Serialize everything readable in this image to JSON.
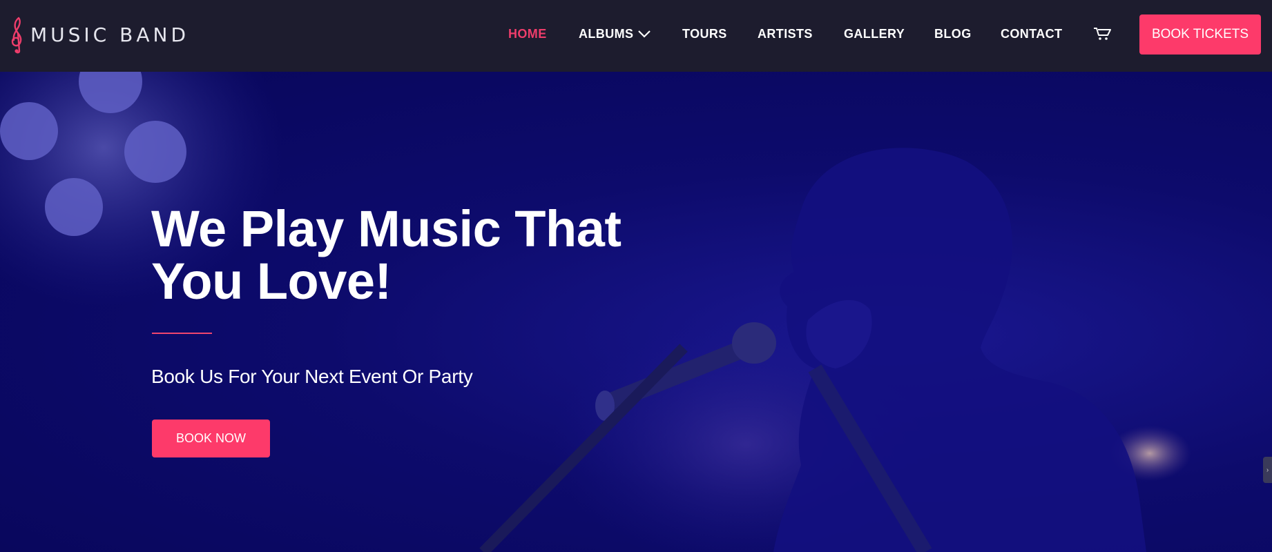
{
  "logo": {
    "text": "MUSIC BAND",
    "icon": "treble-clef-icon"
  },
  "nav": {
    "items": [
      {
        "label": "HOME",
        "active": true
      },
      {
        "label": "ALBUMS",
        "has_dropdown": true
      },
      {
        "label": "TOURS"
      },
      {
        "label": "ARTISTS"
      },
      {
        "label": "GALLERY"
      },
      {
        "label": "BLOG"
      },
      {
        "label": "CONTACT"
      }
    ],
    "cart_icon": "cart-icon",
    "cta_label": "BOOK TICKETS"
  },
  "hero": {
    "headline_line1": "We Play Music That",
    "headline_line2": "You Love!",
    "subtitle": "Book Us For Your Next Event Or Party",
    "button_label": "BOOK NOW"
  },
  "colors": {
    "header_bg": "#1d1c2e",
    "accent": "#fd3a6a",
    "active_nav": "#ee3d6b",
    "hero_bg": "#0a0a55"
  }
}
